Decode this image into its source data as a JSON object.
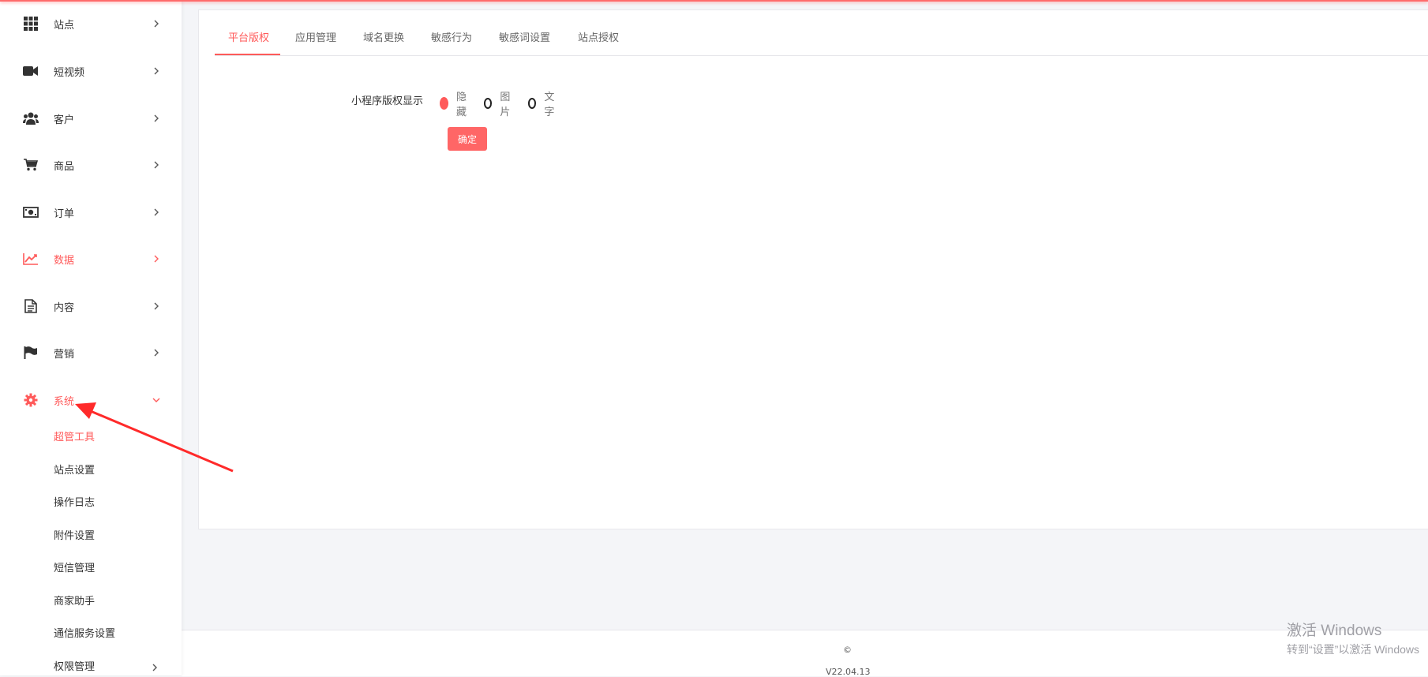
{
  "sidebar": {
    "items": [
      {
        "label": "站点",
        "icon": "grid-icon"
      },
      {
        "label": "短视频",
        "icon": "video-camera-icon"
      },
      {
        "label": "客户",
        "icon": "users-icon"
      },
      {
        "label": "商品",
        "icon": "cart-icon"
      },
      {
        "label": "订单",
        "icon": "money-icon"
      },
      {
        "label": "数据",
        "icon": "line-chart-icon"
      },
      {
        "label": "内容",
        "icon": "document-icon"
      },
      {
        "label": "营销",
        "icon": "flag-icon"
      },
      {
        "label": "系统",
        "icon": "gear-icon"
      }
    ],
    "system_subitems": [
      {
        "label": "超管工具"
      },
      {
        "label": "站点设置"
      },
      {
        "label": "操作日志"
      },
      {
        "label": "附件设置"
      },
      {
        "label": "短信管理"
      },
      {
        "label": "商家助手"
      },
      {
        "label": "通信服务设置"
      },
      {
        "label": "权限管理"
      }
    ]
  },
  "tabs": [
    {
      "label": "平台版权"
    },
    {
      "label": "应用管理"
    },
    {
      "label": "域名更换"
    },
    {
      "label": "敏感行为"
    },
    {
      "label": "敏感词设置"
    },
    {
      "label": "站点授权"
    }
  ],
  "form": {
    "copyright_label": "小程序版权显示",
    "options": [
      {
        "label": "隐藏",
        "checked": true
      },
      {
        "label": "图片",
        "checked": false
      },
      {
        "label": "文字",
        "checked": false
      }
    ],
    "confirm_label": "确定"
  },
  "footer": {
    "copyright": "©",
    "version": "V22.04.13"
  },
  "watermark": {
    "line1": "激活 Windows",
    "line2": "转到“设置”以激活 Windows"
  },
  "colors": {
    "accent": "#ff5a5a",
    "sidebar_bg": "#ffffff",
    "page_bg": "#f4f5f8"
  }
}
